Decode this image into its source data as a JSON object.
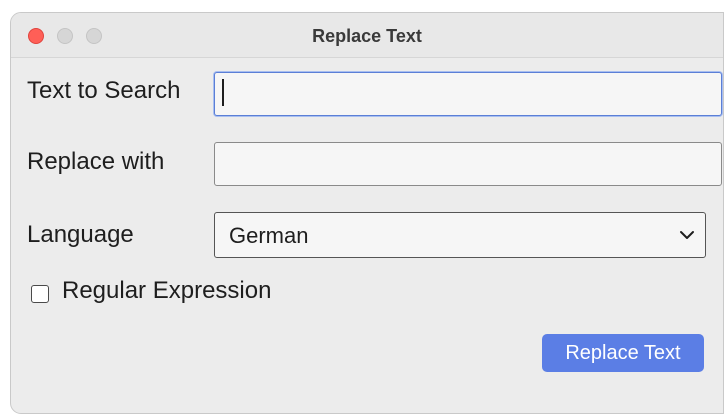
{
  "window": {
    "title": "Replace Text"
  },
  "form": {
    "search_label": "Text to Search",
    "search_value": "",
    "replace_label": "Replace with",
    "replace_value": "",
    "language_label": "Language",
    "language_selected": "German",
    "regex_label": "Regular Expression",
    "regex_checked": false
  },
  "actions": {
    "replace_button_label": "Replace Text"
  },
  "colors": {
    "accent": "#5b7ee5",
    "close_button": "#ff5f57",
    "focus_ring": "#5b7fd6"
  },
  "icons": {
    "select_arrow": "chevron-down-icon"
  }
}
